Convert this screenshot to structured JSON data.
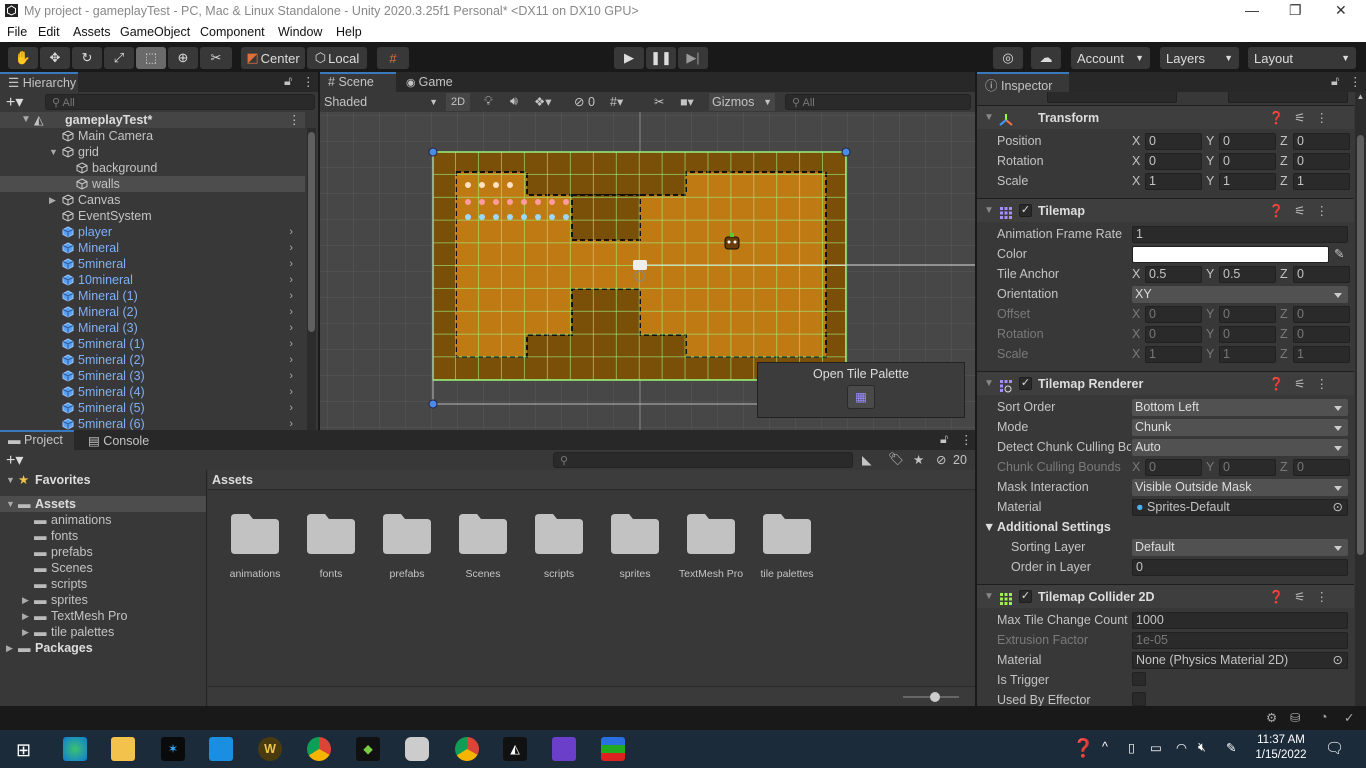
{
  "window": {
    "title": "My project - gameplayTest - PC, Mac & Linux Standalone - Unity 2020.3.25f1 Personal* <DX11 on DX10 GPU>",
    "minimize": "—",
    "restore": "❐",
    "close": "✕"
  },
  "menu": [
    "File",
    "Edit",
    "Assets",
    "GameObject",
    "Component",
    "Window",
    "Help"
  ],
  "toolbar": {
    "pivot": "Center",
    "space": "Local",
    "account": "Account",
    "layers": "Layers",
    "layout": "Layout"
  },
  "hierarchy": {
    "tab": "Hierarchy",
    "search_placeholder": "All",
    "scene": "gameplayTest*",
    "items": [
      {
        "label": "Main Camera",
        "depth": 1,
        "prefab": false
      },
      {
        "label": "grid",
        "depth": 1,
        "prefab": false,
        "expanded": true
      },
      {
        "label": "background",
        "depth": 2,
        "prefab": false
      },
      {
        "label": "walls",
        "depth": 2,
        "prefab": false,
        "selected": true
      },
      {
        "label": "Canvas",
        "depth": 1,
        "prefab": false,
        "collapsed": true
      },
      {
        "label": "EventSystem",
        "depth": 1,
        "prefab": false
      },
      {
        "label": "player",
        "depth": 1,
        "prefab": true
      },
      {
        "label": "Mineral",
        "depth": 1,
        "prefab": true
      },
      {
        "label": "5mineral",
        "depth": 1,
        "prefab": true
      },
      {
        "label": "10mineral",
        "depth": 1,
        "prefab": true
      },
      {
        "label": "Mineral (1)",
        "depth": 1,
        "prefab": true
      },
      {
        "label": "Mineral (2)",
        "depth": 1,
        "prefab": true
      },
      {
        "label": "Mineral (3)",
        "depth": 1,
        "prefab": true
      },
      {
        "label": "5mineral (1)",
        "depth": 1,
        "prefab": true
      },
      {
        "label": "5mineral (2)",
        "depth": 1,
        "prefab": true
      },
      {
        "label": "5mineral (3)",
        "depth": 1,
        "prefab": true
      },
      {
        "label": "5mineral (4)",
        "depth": 1,
        "prefab": true
      },
      {
        "label": "5mineral (5)",
        "depth": 1,
        "prefab": true
      },
      {
        "label": "5mineral (6)",
        "depth": 1,
        "prefab": true
      }
    ]
  },
  "scene": {
    "tabs": [
      "Scene",
      "Game"
    ],
    "shading": "Shaded",
    "mode2d": "2D",
    "hidden_count": "0",
    "gizmos": "Gizmos",
    "search_placeholder": "All",
    "overlay": {
      "title": "Open Tile Palette"
    }
  },
  "inspector": {
    "tab": "Inspector",
    "components": [
      {
        "name": "Transform",
        "icon": "transform-icon",
        "checkbox": false,
        "rows": [
          {
            "type": "xyz",
            "label": "Position",
            "x": "0",
            "y": "0",
            "z": "0"
          },
          {
            "type": "xyz",
            "label": "Rotation",
            "x": "0",
            "y": "0",
            "z": "0"
          },
          {
            "type": "xyz",
            "label": "Scale",
            "x": "1",
            "y": "1",
            "z": "1"
          }
        ]
      },
      {
        "name": "Tilemap",
        "icon": "tilemap-icon",
        "checkbox": true,
        "rows": [
          {
            "type": "field",
            "label": "Animation Frame Rate",
            "value": "1"
          },
          {
            "type": "color",
            "label": "Color",
            "value": "#ffffff"
          },
          {
            "type": "xyz",
            "label": "Tile Anchor",
            "x": "0.5",
            "y": "0.5",
            "z": "0"
          },
          {
            "type": "dropdown",
            "label": "Orientation",
            "value": "XY"
          },
          {
            "type": "xyz",
            "label": "Offset",
            "x": "0",
            "y": "0",
            "z": "0",
            "dim": true
          },
          {
            "type": "xyz",
            "label": "Rotation",
            "x": "0",
            "y": "0",
            "z": "0",
            "dim": true
          },
          {
            "type": "xyz",
            "label": "Scale",
            "x": "1",
            "y": "1",
            "z": "1",
            "dim": true
          }
        ]
      },
      {
        "name": "Tilemap Renderer",
        "icon": "tilemap-renderer-icon",
        "checkbox": true,
        "rows": [
          {
            "type": "dropdown",
            "label": "Sort Order",
            "value": "Bottom Left"
          },
          {
            "type": "dropdown",
            "label": "Mode",
            "value": "Chunk"
          },
          {
            "type": "dropdown",
            "label": "Detect Chunk Culling Bounds",
            "value": "Auto"
          },
          {
            "type": "xyz",
            "label": "Chunk Culling Bounds",
            "x": "0",
            "y": "0",
            "z": "0",
            "dim": true
          },
          {
            "type": "dropdown",
            "label": "Mask Interaction",
            "value": "Visible Outside Mask"
          },
          {
            "type": "object",
            "label": "Material",
            "value": "Sprites-Default",
            "dot": true
          },
          {
            "type": "subheader",
            "label": "Additional Settings"
          },
          {
            "type": "dropdown",
            "label": "Sorting Layer",
            "value": "Default",
            "indent": true
          },
          {
            "type": "field",
            "label": "Order in Layer",
            "value": "0",
            "indent": true
          }
        ]
      },
      {
        "name": "Tilemap Collider 2D",
        "icon": "tilemap-collider-icon",
        "checkbox": true,
        "rows": [
          {
            "type": "field",
            "label": "Max Tile Change Count",
            "value": "1000"
          },
          {
            "type": "field",
            "label": "Extrusion Factor",
            "value": "1e-05",
            "dim": true
          },
          {
            "type": "object",
            "label": "Material",
            "value": "None (Physics Material 2D)"
          },
          {
            "type": "check",
            "label": "Is Trigger"
          },
          {
            "type": "check",
            "label": "Used By Effector"
          }
        ]
      }
    ]
  },
  "project": {
    "tabs": [
      "Project",
      "Console"
    ],
    "hidden_count": "20",
    "breadcrumb": "Assets",
    "tree": [
      {
        "label": "Favorites",
        "depth": 0,
        "star": true
      },
      {
        "label": "Assets",
        "depth": 0,
        "selected": true
      },
      {
        "label": "animations",
        "depth": 1
      },
      {
        "label": "fonts",
        "depth": 1
      },
      {
        "label": "prefabs",
        "depth": 1
      },
      {
        "label": "Scenes",
        "depth": 1
      },
      {
        "label": "scripts",
        "depth": 1
      },
      {
        "label": "sprites",
        "depth": 1,
        "collapsed": true
      },
      {
        "label": "TextMesh Pro",
        "depth": 1,
        "collapsed": true
      },
      {
        "label": "tile palettes",
        "depth": 1,
        "collapsed": true
      },
      {
        "label": "Packages",
        "depth": 0,
        "collapsed": true
      }
    ],
    "folders": [
      "animations",
      "fonts",
      "prefabs",
      "Scenes",
      "scripts",
      "sprites",
      "TextMesh Pro",
      "tile palettes"
    ]
  },
  "taskbar": {
    "time": "11:37 AM",
    "date": "1/15/2022",
    "apps": [
      "windows-start",
      "edge",
      "file-explorer",
      "app-blue",
      "mail",
      "world-of-warcraft",
      "chrome",
      "minecraft",
      "unity-hub",
      "chrome-profile",
      "unity",
      "visual-studio",
      "tile-app"
    ]
  }
}
